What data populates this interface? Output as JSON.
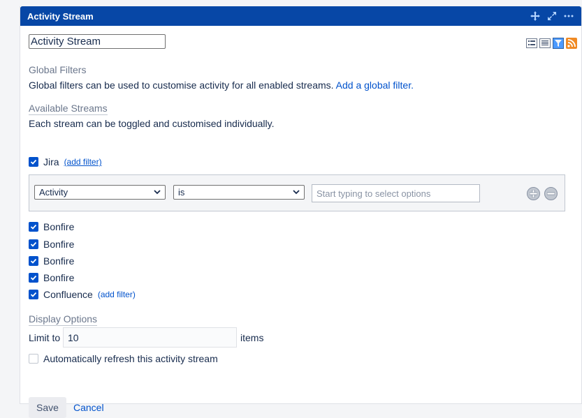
{
  "gadget": {
    "header_title": "Activity Stream",
    "title_value": "Activity Stream"
  },
  "icons": {
    "move": "move-icon",
    "maximize": "maximize-icon",
    "more": "more-icon",
    "list_view": "list-view-icon",
    "detail_view": "detail-view-icon",
    "filter_view": "filter-view-icon",
    "rss": "rss-icon"
  },
  "global_filters": {
    "heading": "Global Filters",
    "description": "Global filters can be used to customise activity for all enabled streams.",
    "add_link": "Add a global filter."
  },
  "streams": {
    "heading": "Available Streams",
    "description": "Each stream can be toggled and customised individually.",
    "add_filter_label": "(add filter)",
    "items": [
      {
        "label": "Jira",
        "checked": true
      },
      {
        "label": "Bonfire",
        "checked": true
      },
      {
        "label": "Bonfire",
        "checked": true
      },
      {
        "label": "Bonfire",
        "checked": true
      },
      {
        "label": "Bonfire",
        "checked": true
      },
      {
        "label": "Confluence",
        "checked": true
      }
    ]
  },
  "filter_row": {
    "field": "Activity",
    "operator": "is",
    "value_placeholder": "Start typing to select options"
  },
  "display_options": {
    "heading": "Display Options",
    "limit_label": "Limit to",
    "limit_value": "10",
    "limit_suffix": "items",
    "auto_refresh_label": "Automatically refresh this activity stream",
    "auto_refresh_checked": false
  },
  "actions": {
    "save": "Save",
    "cancel": "Cancel"
  },
  "colors": {
    "header": "#0747a6",
    "link": "#0052cc",
    "checkbox": "#0052cc"
  }
}
